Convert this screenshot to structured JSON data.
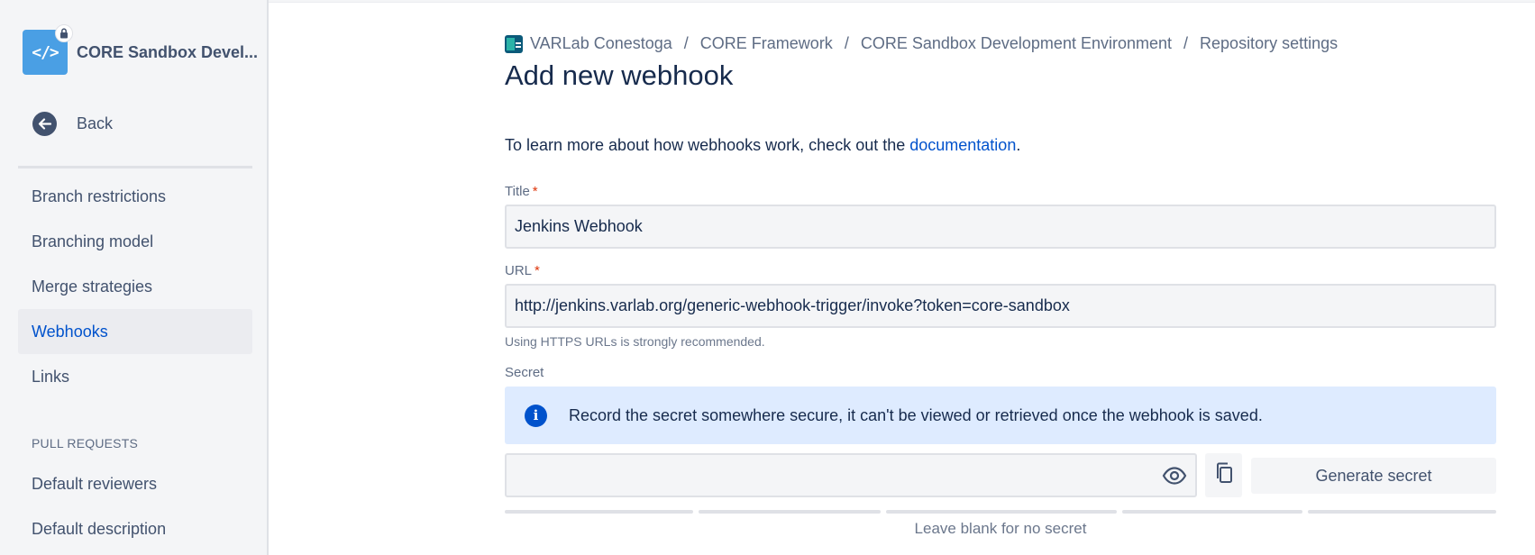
{
  "sidebar": {
    "repo_name": "CORE Sandbox Devel...",
    "repo_icon": "code-icon",
    "back_label": "Back",
    "items": [
      {
        "label": "Branch restrictions",
        "active": false
      },
      {
        "label": "Branching model",
        "active": false
      },
      {
        "label": "Merge strategies",
        "active": false
      },
      {
        "label": "Webhooks",
        "active": true
      },
      {
        "label": "Links",
        "active": false
      }
    ],
    "section_pull_requests": "PULL REQUESTS",
    "pr_items": [
      {
        "label": "Default reviewers"
      },
      {
        "label": "Default description"
      }
    ]
  },
  "breadcrumb": {
    "workspace": "VARLab Conestoga",
    "project": "CORE Framework",
    "repository": "CORE Sandbox Development Environment",
    "page": "Repository settings",
    "separator": "/"
  },
  "page": {
    "title": "Add new webhook",
    "intro_text": "To learn more about how webhooks work, check out the ",
    "intro_link": "documentation",
    "intro_end": "."
  },
  "form": {
    "title_label": "Title",
    "title_value": "Jenkins Webhook",
    "url_label": "URL",
    "url_value": "http://jenkins.varlab.org/generic-webhook-trigger/invoke?token=core-sandbox",
    "url_helper": "Using HTTPS URLs is strongly recommended.",
    "required_mark": "*",
    "secret_label": "Secret",
    "secret_info": "Record the secret somewhere secure, it can't be viewed or retrieved once the webhook is saved.",
    "secret_value": "",
    "generate_label": "Generate secret",
    "secret_hint": "Leave blank for no secret"
  },
  "colors": {
    "accent": "#0052cc",
    "info_bg": "#deebff",
    "required": "#de350b",
    "sidebar_bg": "#f4f5f7"
  }
}
